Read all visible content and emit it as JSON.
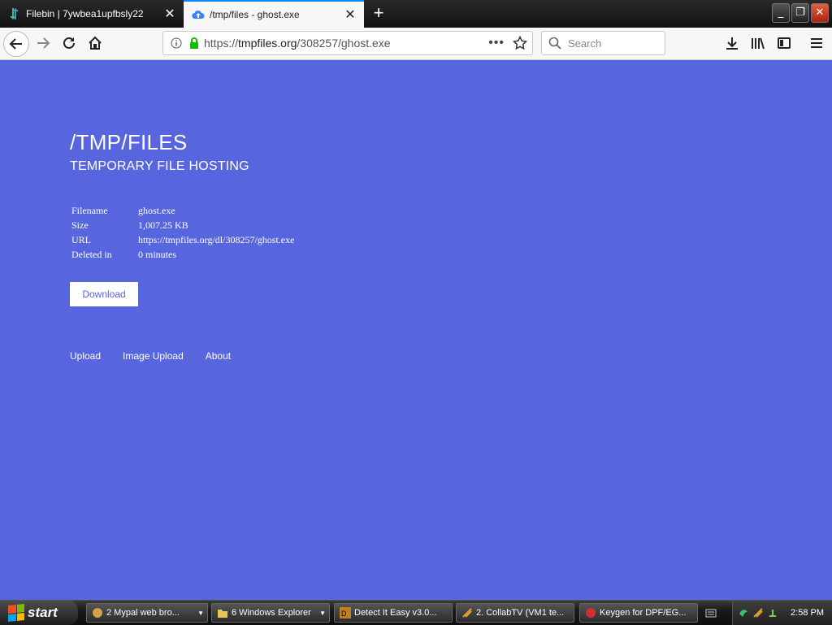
{
  "browser": {
    "tabs": [
      {
        "title": "Filebin | 7ywbea1upfbsly22",
        "active": false
      },
      {
        "title": "/tmp/files - ghost.exe",
        "active": true
      }
    ],
    "url_prefix": "https://",
    "url_host": "tmpfiles.org",
    "url_path": "/308257/ghost.exe",
    "search_placeholder": "Search"
  },
  "page": {
    "title": "/TMP/FILES",
    "subtitle": "TEMPORARY FILE HOSTING",
    "info": [
      {
        "key": "Filename",
        "value": "ghost.exe"
      },
      {
        "key": "Size",
        "value": "1,007.25 KB"
      },
      {
        "key": "URL",
        "value": "https://tmpfiles.org/dl/308257/ghost.exe"
      },
      {
        "key": "Deleted in",
        "value": "0 minutes"
      }
    ],
    "download_label": "Download",
    "links": [
      "Upload",
      "Image Upload",
      "About"
    ],
    "background_color": "#5765de"
  },
  "taskbar": {
    "start_label": "start",
    "tasks": [
      {
        "label": "2 Mypal web bro...",
        "has_menu": true
      },
      {
        "label": "6 Windows Explorer",
        "has_menu": true
      },
      {
        "label": "Detect It Easy v3.0...",
        "has_menu": false
      },
      {
        "label": "2. CollabTV (VM1 te...",
        "has_menu": false
      },
      {
        "label": "Keygen for DPF/EG...",
        "has_menu": false
      }
    ],
    "clock": "2:58 PM"
  }
}
